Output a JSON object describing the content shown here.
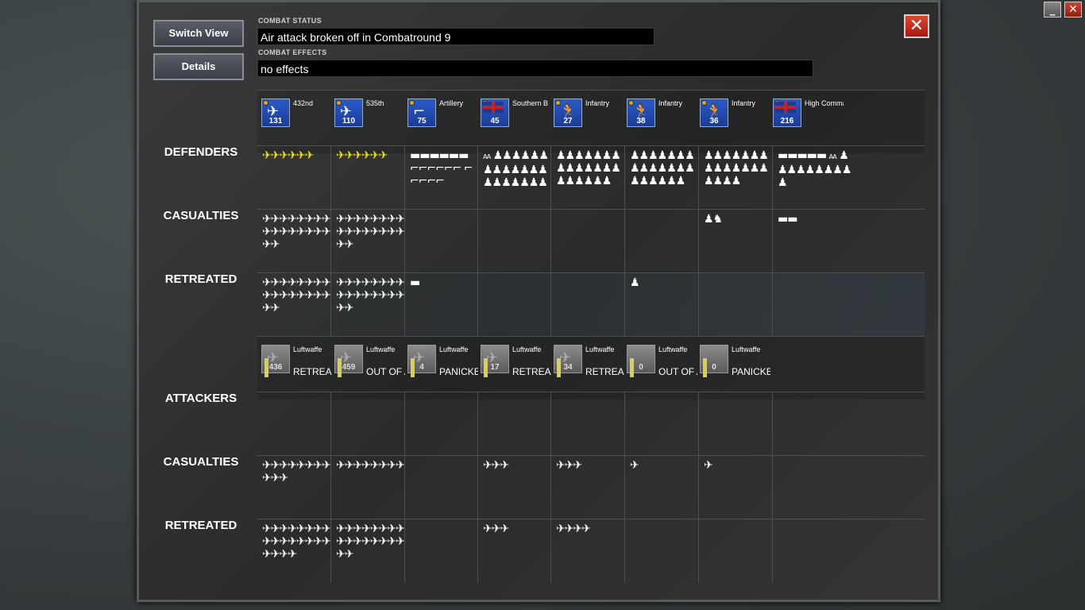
{
  "window_controls": {
    "minimize_label": "_",
    "close_label": "✕"
  },
  "buttons": {
    "switch_view": "Switch View",
    "details": "Details",
    "close": "✕"
  },
  "combat_status": {
    "label": "COMBAT STATUS",
    "value": "Air attack broken off in Combatround  9"
  },
  "combat_effects": {
    "label": "COMBAT EFFECTS",
    "value": "no effects"
  },
  "row_labels": {
    "defenders": "DEFENDERS",
    "casualties": "CASUALTIES",
    "retreated": "RETREATED",
    "attackers": "ATTACKERS"
  },
  "defender_units": [
    {
      "name": "432nd",
      "strength": "131",
      "icon": "plane-icon"
    },
    {
      "name": "535th",
      "strength": "110",
      "icon": "plane-icon"
    },
    {
      "name": "Artillery",
      "strength": "75",
      "icon": "artillery-icon"
    },
    {
      "name": "Southern B",
      "strength": "45",
      "icon": "uk-flag-icon"
    },
    {
      "name": "Infantry",
      "strength": "27",
      "icon": "infantry-icon"
    },
    {
      "name": "Infantry",
      "strength": "38",
      "icon": "infantry-icon"
    },
    {
      "name": "Infantry",
      "strength": "36",
      "icon": "infantry-icon"
    },
    {
      "name": "High Command",
      "strength": "216",
      "icon": "uk-flag-icon"
    }
  ],
  "attacker_units": [
    {
      "name": "Luftwaffe",
      "strength": "436",
      "status": "RETREA"
    },
    {
      "name": "Luftwaffe",
      "strength": "459",
      "status": "OUT OF A"
    },
    {
      "name": "Luftwaffe",
      "strength": "4",
      "status": "PANICKE"
    },
    {
      "name": "Luftwaffe",
      "strength": "17",
      "status": "RETREA"
    },
    {
      "name": "Luftwaffe",
      "strength": "34",
      "status": "RETREA"
    },
    {
      "name": "Luftwaffe",
      "strength": "0",
      "status": "OUT OF A"
    },
    {
      "name": "Luftwaffe",
      "strength": "0",
      "status": "PANICKED"
    }
  ],
  "sprite_text": {
    "aa": "AA"
  },
  "colors": {
    "close_button": "#c8281a",
    "defender_icon": "#2a5ac8",
    "attacker_icon": "#6a6a6a",
    "sprite_yellow": "#f0e020"
  }
}
